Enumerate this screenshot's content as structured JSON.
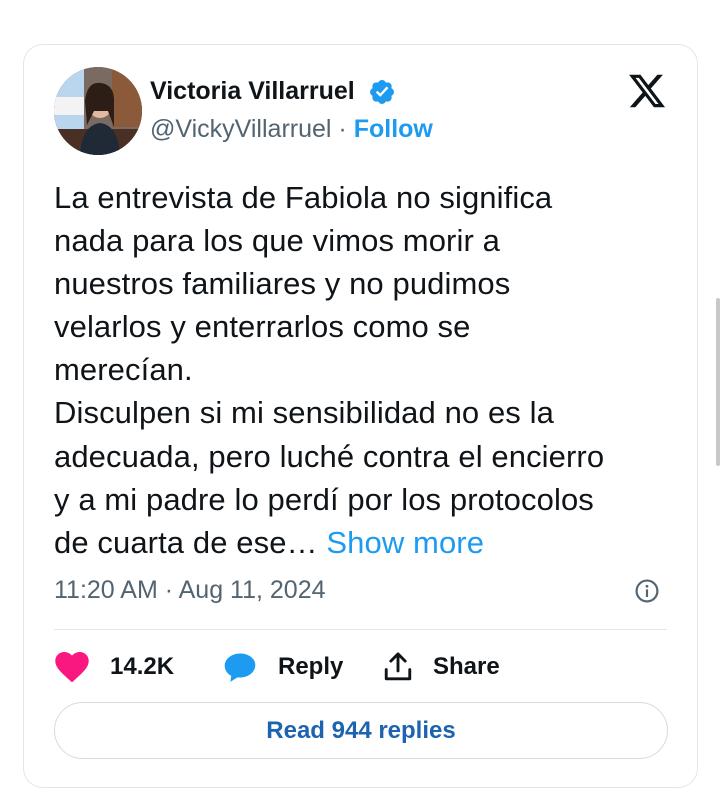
{
  "tweet": {
    "author_name": "Victoria Villarruel",
    "handle": "@VickyVillarruel",
    "separator": "·",
    "follow_label": "Follow",
    "text": "La entrevista de Fabiola no significa\nnada para los que vimos morir a\nnuestros familiares y no pudimos\nvelarlos y enterrarlos como se\nmerecían.\nDisculpen si mi sensibilidad no es la\nadecuada, pero luché contra el encierro\ny a mi padre lo perdí por los protocolos\nde cuarta de ese…",
    "show_more_label": "Show more",
    "timestamp": "11:20 AM · Aug 11, 2024"
  },
  "actions": {
    "like_count": "14.2K",
    "reply_label": "Reply",
    "share_label": "Share"
  },
  "read_replies_label": "Read 944 replies",
  "icons": {
    "brand": "x-logo-icon",
    "verified": "verified-badge-icon",
    "info": "info-icon",
    "like": "heart-icon",
    "reply": "speech-bubble-icon",
    "share": "share-upload-icon"
  },
  "colors": {
    "accent": "#1d9bf0",
    "like": "#f91880",
    "text": "#0f1419",
    "muted": "#536471"
  }
}
